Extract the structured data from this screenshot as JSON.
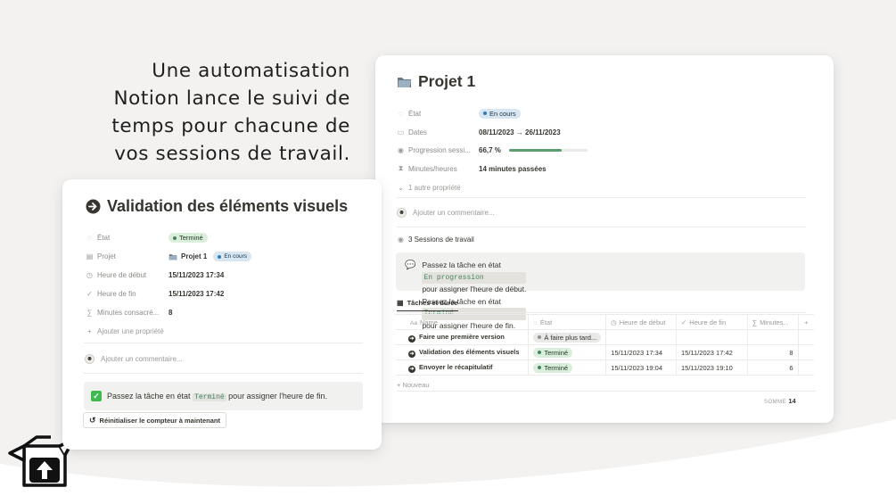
{
  "headline": [
    "Une automatisation",
    "Notion lance le suivi de",
    "temps pour chacune de",
    "vos sessions de travail."
  ],
  "project_card": {
    "title": "Projet 1",
    "title_icon": "folder-icon",
    "properties": [
      {
        "name": "État",
        "icon": "status-icon",
        "type": "pill",
        "value": "En cours",
        "pill_color": "#d8e6f1"
      },
      {
        "name": "Dates",
        "icon": "calendar-icon",
        "type": "text",
        "value": "08/11/2023 → 26/11/2023"
      },
      {
        "name": "Progression sessi...",
        "icon": "progress-icon",
        "type": "progress",
        "value": "66,7 %",
        "fraction": 0.667
      },
      {
        "name": "Minutes/heures",
        "icon": "hourglass-icon",
        "type": "text",
        "value": "14 minutes passées"
      }
    ],
    "more_props": "1 autre propriété",
    "comment_placeholder": "Ajouter un commentaire...",
    "sessions_label": "3 Sessions de travail",
    "callout": {
      "line1_a": "Passez la tâche en état ",
      "line1_code": "En progression",
      "line1_b": " pour assigner l'heure de début.",
      "line2_a": "Passez la tâche en état ",
      "line2_code": "Terminé",
      "line2_b": " pour assigner l'heure de fin."
    },
    "table_tab": "Tâches et durée",
    "columns": [
      "Name",
      "État",
      "Heure de début",
      "Heure de fin",
      "Minutes...",
      "+"
    ],
    "rows": [
      {
        "name": "Faire une première version",
        "state": "À faire plus tard...",
        "state_color": "gray",
        "start": "",
        "end": "",
        "minutes": ""
      },
      {
        "name": "Validation des éléments visuels",
        "state": "Terminé",
        "state_color": "green",
        "start": "15/11/2023 17:34",
        "end": "15/11/2023 17:42",
        "minutes": "8"
      },
      {
        "name": "Envoyer le récapitulatif",
        "state": "Terminé",
        "state_color": "green",
        "start": "15/11/2023 19:04",
        "end": "15/11/2023 19:10",
        "minutes": "6"
      }
    ],
    "new_label": "+ Nouveau",
    "sum_label": "SOMME",
    "sum_value": "14"
  },
  "task_card": {
    "title": "Validation des éléments visuels",
    "title_icon": "arrow-circle-icon",
    "properties": [
      {
        "name": "État",
        "icon": "status-icon",
        "value": "Terminé"
      },
      {
        "name": "Projet",
        "icon": "document-icon",
        "value": "Projet 1",
        "pill": "En cours"
      },
      {
        "name": "Heure de début",
        "icon": "clock-icon",
        "value": "15/11/2023 17:34"
      },
      {
        "name": "Heure de fin",
        "icon": "checkmark-icon",
        "value": "15/11/2023 17:42"
      },
      {
        "name": "Minutes consacré...",
        "icon": "formula-icon",
        "value": "8"
      }
    ],
    "add_property": "Ajouter une propriété",
    "comment_placeholder": "Ajouter un commentaire...",
    "callout": {
      "text_a": "Passez la tâche en état ",
      "code": "Terminé",
      "text_b": " pour assigner l'heure de fin."
    },
    "reset_button": "Réinitialiser le compteur à maintenant"
  }
}
